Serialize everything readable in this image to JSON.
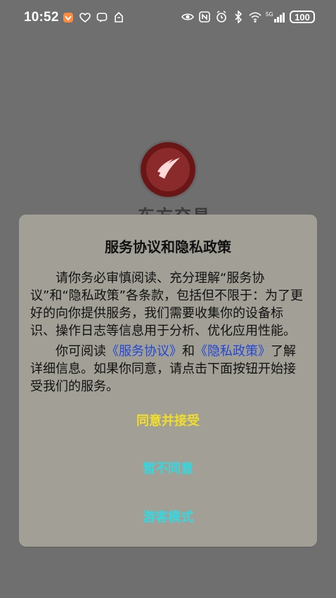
{
  "status_bar": {
    "time": "10:52",
    "battery": "100",
    "network": "5G",
    "left_icons": [
      "app-icon",
      "heart-icon",
      "chat-icon",
      "hand-icon"
    ],
    "right_icons": [
      "eye-icon",
      "nfc-icon",
      "alarm-icon",
      "bluetooth-icon",
      "wifi-icon",
      "signal-icon",
      "battery-icon"
    ]
  },
  "background": {
    "brand_text": "东方交易"
  },
  "dialog": {
    "title": "服务协议和隐私政策",
    "paragraph1": "请你务必审慎阅读、充分理解“服务协议”和“隐私政策”各条款，包括但不限于：为了更好的向你提供服务，我们需要收集你的设备标识、操作日志等信息用于分析、优化应用性能。",
    "paragraph2_prefix": "你可阅读",
    "link_service": "《服务协议》",
    "and_text": "和",
    "link_privacy": "《隐私政策》",
    "paragraph2_suffix": "了解详细信息。如果你同意，请点击下面按钮开始接受我们的服务。",
    "buttons": {
      "agree": "同意并接受",
      "disagree": "暂不同意",
      "guest": "游客模式"
    }
  },
  "colors": {
    "overlay_bg": "#6f6f6f",
    "dialog_bg": "#a2a096",
    "link": "#2147d8",
    "agree": "#f0de2a",
    "secondary": "#33d8e0"
  }
}
